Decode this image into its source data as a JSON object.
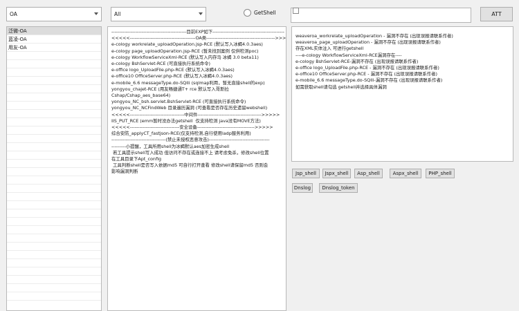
{
  "toolbar": {
    "product_select": "OA",
    "module_select": "All",
    "getshell_label": "GetShell",
    "url_value": "",
    "att_label": "ATT"
  },
  "sidebar": {
    "items": [
      "泛微-OA",
      "蓝凌-OA",
      "用友-OA"
    ]
  },
  "exploit_list": [
    "-----------------------------------------------目前EXP如下---------------------------------------------",
    "",
    "<<<<<-----------------------------------------OA类------------------------------------------->>>>>",
    "e-cology workrelate_uploadOperation.jsp-RCE (默认写入冰蝎4.0.3aes)",
    "e-cology page_uploadOperation.jsp-RCE (暂未找到案例 仅供检测poc)",
    "e-cology WorkflowServiceXml-RCE (默认写入内存马 冰蝎 3.0 beta11)",
    "e-cology BshServlet-RCE (可直接执行系统命令)",
    "e-office logo_UploadFile.php-RCE (默认写入冰蝎4.0.3aes)",
    "e-office10 OfficeServer.php-RCE (默认写入冰蝎4.0.3aes)",
    "e-mobile_6.6 messageType.do-SQlli (sqlmap利用，暂无直接shell的exp)",
    "",
    "yongyou_chajet-RCE (用友畅捷通T+ rce 默认写入哥斯拉",
    "Cshap/Cshap_aes_base64)",
    "yongyou_NC_bsh.servlet.BshServlet-RCE (可直接执行系统命令)",
    "yongyou_NC_NCFindWeb 目录遍历漏洞 (可查看是否存在历史遗留webshell)",
    "",
    "<<<<<----------------------------------中间件---------------------------------------->>>>>",
    "IIS_PUT_RCE (emm暂时没办法getshell  仅支持检测 java没有MOVE方法)",
    "",
    "<<<<<-------------------------------安全设备------------------------------------>>>>>",
    "综合安防_applyCT_fastjson-RCE(仅支持检测,自行使用ladp服务利用)",
    "",
    "----------------------------------(禁止未授权恶意攻击)--------------------------------------",
    "",
    "---------小提醒，工具所用shell为冰蝎默认aes加密生成shell",
    " 若工具提示shell写入成功 但访问不存在或连接不上 请考虑免杀，修改shell位置",
    "在工具目录下Apt_config",
    " 工具判断shell是否写入依据md5 可自行打开查看 修改shell请保留md5 否则会",
    "影响漏洞判断"
  ],
  "result_output": [
    "weaveroa_workrelate_uploadOperation - 漏洞不存在 (出现误报请联系作者)",
    "weaveroa_page_uploadOperation - 漏洞不存在 (出现误报请联系作者)",
    "存在XML实体注入 可进行getshell",
    "----e-cology WorkflowServiceXml-RCE漏洞存在----",
    "",
    "e-cology BshServlet-RCE-漏洞不存在 (出现误报请联系作者)",
    "e-office logo_UploadFile.php-RCE - 漏洞不存在 (出现误报请联系作者)",
    "e-office10 OfficeServer.php-RCE - 漏洞不存在 (出现误报请联系作者)",
    "e-mobile_6.6 messageType.do-SQlli-漏洞不存在 (出现误报请联系作者)",
    "",
    "如需获取shell请勾选 getshell并选择具体漏洞"
  ],
  "shell_buttons": [
    "Jsp_shell",
    "Jspx_shell",
    "Asp_shell",
    "Aspx_shell",
    "PHP_shell",
    "Dnslog",
    "Dnslog_token"
  ]
}
